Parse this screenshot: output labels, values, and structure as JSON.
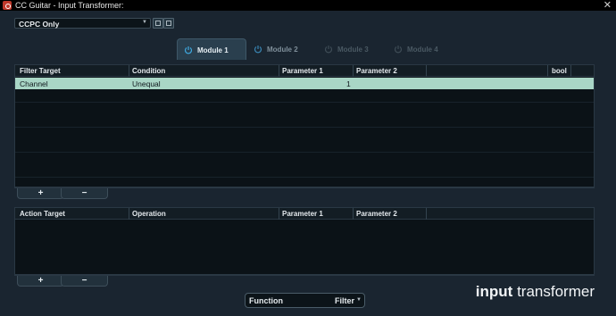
{
  "window": {
    "title": "CC Guitar - Input Transformer:",
    "close_glyph": "✕"
  },
  "preset": {
    "value": "CCPC Only"
  },
  "modules": [
    {
      "label": "Module 1",
      "state": "active"
    },
    {
      "label": "Module 2",
      "state": "enabled"
    },
    {
      "label": "Module 3",
      "state": "disabled"
    },
    {
      "label": "Module 4",
      "state": "disabled"
    }
  ],
  "filter_table": {
    "columns": [
      "Filter Target",
      "Condition",
      "Parameter 1",
      "Parameter 2",
      "bool"
    ],
    "rows": [
      {
        "target": "Channel",
        "condition": "Unequal",
        "param1": "1",
        "param2": "",
        "bool": ""
      }
    ]
  },
  "action_table": {
    "columns": [
      "Action Target",
      "Operation",
      "Parameter 1",
      "Parameter 2"
    ],
    "rows": []
  },
  "buttons": {
    "add": "+",
    "remove": "−"
  },
  "function": {
    "label": "Function",
    "value": "Filter"
  },
  "brand": {
    "bold": "input",
    "normal": "transformer"
  },
  "colors": {
    "accent": "#3fa9e0",
    "selected_row": "#a9d6c6",
    "panel_bg": "#0b1217",
    "window_bg": "#1a2530"
  }
}
